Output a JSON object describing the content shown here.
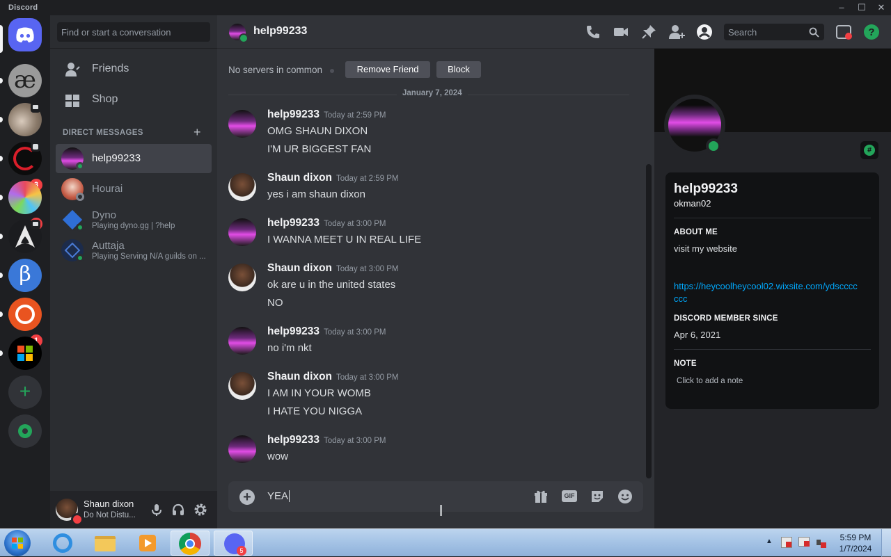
{
  "window": {
    "title": "Discord",
    "controls": [
      "minimize-icon",
      "maximize-icon",
      "close-icon"
    ]
  },
  "servers": [
    {
      "name": "discord-home",
      "badge": ""
    },
    {
      "name": "server-ae",
      "badge": ""
    },
    {
      "name": "server-cat",
      "badge": ""
    },
    {
      "name": "server-red-ring",
      "badge": "3"
    },
    {
      "name": "server-colorful",
      "badge": "1"
    },
    {
      "name": "server-arch",
      "badge": ""
    },
    {
      "name": "server-beta",
      "badge": ""
    },
    {
      "name": "server-ubuntu",
      "badge": "1"
    },
    {
      "name": "server-windows",
      "badge": ""
    }
  ],
  "sidebar": {
    "search_placeholder": "Find or start a conversation",
    "friends": "Friends",
    "shop": "Shop",
    "dm_header": "DIRECT MESSAGES",
    "dm_add": "+",
    "dms": [
      {
        "name": "help99233",
        "sub": ""
      },
      {
        "name": "Hourai",
        "sub": ""
      },
      {
        "name": "Dyno",
        "sub": "Playing dyno.gg | ?help"
      },
      {
        "name": "Auttaja",
        "sub": "Playing Serving N/A guilds on ..."
      }
    ]
  },
  "user": {
    "name": "Shaun dixon",
    "status": "Do Not Distu..."
  },
  "chat": {
    "recipient": "help99233",
    "search_placeholder": "Search",
    "no_servers": "No servers in common",
    "remove_friend": "Remove Friend",
    "block": "Block",
    "date_divider": "January 7, 2024",
    "messages": [
      {
        "author": "help99233",
        "time": "Today at 2:59 PM",
        "lines": [
          "OMG SHAUN DIXON",
          "I'M UR BIGGEST FAN"
        ]
      },
      {
        "author": "Shaun dixon",
        "time": "Today at 2:59 PM",
        "lines": [
          "yes i am shaun dixon"
        ]
      },
      {
        "author": "help99233",
        "time": "Today at 3:00 PM",
        "lines": [
          "I WANNA MEET U IN REAL LIFE"
        ]
      },
      {
        "author": "Shaun dixon",
        "time": "Today at 3:00 PM",
        "lines": [
          "ok are u in the united states",
          "NO"
        ]
      },
      {
        "author": "help99233",
        "time": "Today at 3:00 PM",
        "lines": [
          "no i'm nkt"
        ]
      },
      {
        "author": "Shaun dixon",
        "time": "Today at 3:00 PM",
        "lines": [
          "I AM IN YOUR WOMB",
          "I HATE YOU NIGGA"
        ]
      },
      {
        "author": "help99233",
        "time": "Today at 3:00 PM",
        "lines": [
          "wow"
        ]
      }
    ],
    "composer_value": "YEA",
    "gif_label": "GIF"
  },
  "profile": {
    "display_name": "help99233",
    "username": "okman02",
    "about_title": "ABOUT ME",
    "about_text": "visit my website",
    "link_line1": "https://heycoolheycool02.wixsite.com/ydscccc",
    "link_line2": "ccc",
    "member_since_title": "DISCORD MEMBER SINCE",
    "member_since": "Apr 6, 2021",
    "note_title": "NOTE",
    "note_placeholder": "Click to add a note",
    "badge": "#"
  },
  "taskbar": {
    "time": "5:59 PM",
    "date": "1/7/2024",
    "discord_badge": "5",
    "apps": [
      "start-orb",
      "internet-explorer",
      "file-explorer",
      "media-player",
      "chrome",
      "discord"
    ]
  },
  "colors": {
    "accent": "#5865f2",
    "online": "#23a55a",
    "dnd": "#f23f43",
    "link": "#00a8fc"
  }
}
